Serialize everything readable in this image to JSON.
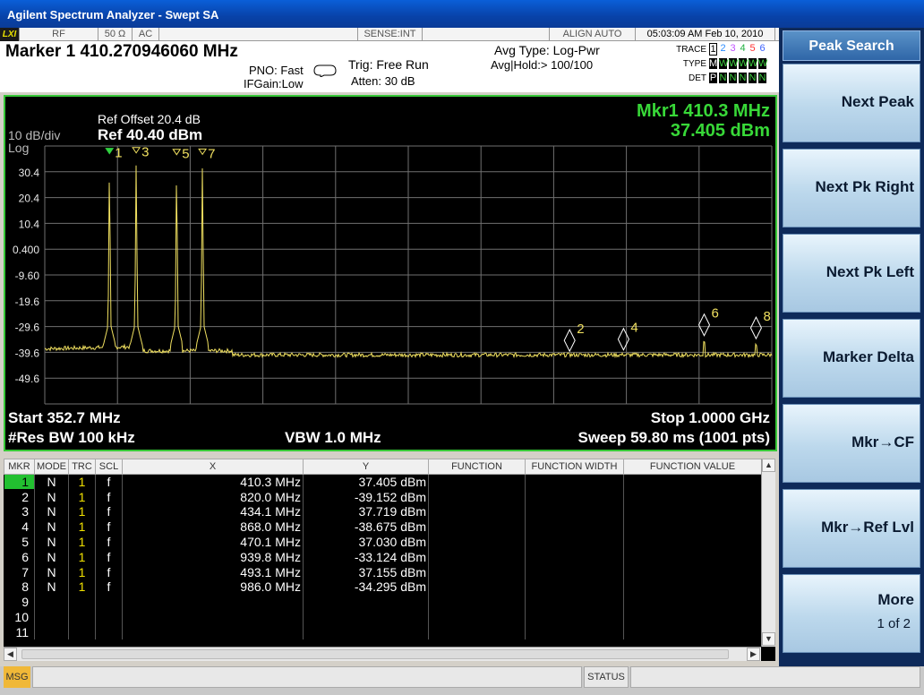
{
  "window": {
    "title": "Agilent Spectrum Analyzer - Swept SA"
  },
  "status_row": {
    "lxi": "LXI",
    "rf": "RF",
    "impedance": "50 Ω",
    "coupling": "AC",
    "sense": "SENSE:INT",
    "align": "ALIGN AUTO",
    "datetime": "05:03:09 AM Feb 10, 2010"
  },
  "marker_readout": "Marker 1 410.270946060 MHz",
  "settings": {
    "pno": "PNO: Fast",
    "ifgain": "IFGain:Low",
    "trig": "Trig: Free Run",
    "atten": "Atten: 30 dB",
    "avg_type": "Avg Type: Log-Pwr",
    "avg_hold": "Avg|Hold:> 100/100"
  },
  "trace_box": {
    "trace_label": "TRACE",
    "trace_vals": [
      "1",
      "2",
      "3",
      "4",
      "5",
      "6"
    ],
    "trace_colors": [
      "#e8d800",
      "#2a8cff",
      "#c050ff",
      "#20b040",
      "#ff3030",
      "#3a60ff"
    ],
    "type_label": "TYPE",
    "type_vals": [
      "M",
      "W",
      "W",
      "W",
      "W",
      "W"
    ],
    "det_label": "DET",
    "det_vals": [
      "P",
      "N",
      "N",
      "N",
      "N",
      "N"
    ]
  },
  "plot": {
    "ref_offset": "Ref Offset 20.4 dB",
    "ref_level": "Ref 40.40 dBm",
    "scale": "10 dB/div",
    "scale_type": "Log",
    "mkr_freq": "Mkr1 410.3 MHz",
    "mkr_amp": "37.405 dBm",
    "y_ticks": [
      "30.4",
      "20.4",
      "10.4",
      "0.400",
      "-9.60",
      "-19.6",
      "-29.6",
      "-39.6",
      "-49.6"
    ],
    "start": "Start 352.7 MHz",
    "stop": "Stop 1.0000 GHz",
    "res_bw": "#Res BW 100 kHz",
    "vbw": "VBW 1.0 MHz",
    "sweep": "Sweep  59.80 ms (1001 pts)",
    "trace_color": "#f0e060",
    "grid_color": "#707070"
  },
  "chart_data": {
    "type": "line",
    "title": "",
    "xlabel": "",
    "ylabel": "",
    "x_unit": "MHz",
    "y_unit": "dBm",
    "xlim": [
      352.7,
      1000.0
    ],
    "ylim": [
      -59.6,
      40.4
    ],
    "noise_floor_low_band": -38.2,
    "noise_floor_high_band": -40.6,
    "peaks": [
      {
        "marker": "1",
        "x": 410.3,
        "y": 37.405
      },
      {
        "marker": "3",
        "x": 434.1,
        "y": 37.719
      },
      {
        "marker": "5",
        "x": 470.1,
        "y": 37.03
      },
      {
        "marker": "7",
        "x": 493.1,
        "y": 37.155
      },
      {
        "marker": "2",
        "x": 820.0,
        "y": -39.152
      },
      {
        "marker": "4",
        "x": 868.0,
        "y": -38.675
      },
      {
        "marker": "6",
        "x": 939.8,
        "y": -33.124
      },
      {
        "marker": "8",
        "x": 986.0,
        "y": -34.295
      }
    ]
  },
  "table": {
    "headers": [
      "MKR",
      "MODE",
      "TRC",
      "SCL",
      "X",
      "Y",
      "FUNCTION",
      "FUNCTION WIDTH",
      "FUNCTION VALUE"
    ],
    "rows": [
      [
        "1",
        "N",
        "1",
        "f",
        "410.3 MHz",
        "37.405 dBm"
      ],
      [
        "2",
        "N",
        "1",
        "f",
        "820.0 MHz",
        "-39.152 dBm"
      ],
      [
        "3",
        "N",
        "1",
        "f",
        "434.1 MHz",
        "37.719 dBm"
      ],
      [
        "4",
        "N",
        "1",
        "f",
        "868.0 MHz",
        "-38.675 dBm"
      ],
      [
        "5",
        "N",
        "1",
        "f",
        "470.1 MHz",
        "37.030 dBm"
      ],
      [
        "6",
        "N",
        "1",
        "f",
        "939.8 MHz",
        "-33.124 dBm"
      ],
      [
        "7",
        "N",
        "1",
        "f",
        "493.1 MHz",
        "37.155 dBm"
      ],
      [
        "8",
        "N",
        "1",
        "f",
        "986.0 MHz",
        "-34.295 dBm"
      ],
      [
        "9",
        "",
        "",
        "",
        "",
        ""
      ],
      [
        "10",
        "",
        "",
        "",
        "",
        ""
      ],
      [
        "11",
        "",
        "",
        "",
        "",
        ""
      ]
    ],
    "active_row": 0
  },
  "statusbar": {
    "msg": "MSG",
    "status": "STATUS"
  },
  "softkeys": {
    "title": "Peak Search",
    "keys": [
      {
        "label": "Next Peak",
        "sub": ""
      },
      {
        "label": "Next Pk Right",
        "sub": ""
      },
      {
        "label": "Next Pk Left",
        "sub": ""
      },
      {
        "label": "Marker Delta",
        "sub": ""
      },
      {
        "label": "Mkr→CF",
        "sub": ""
      },
      {
        "label": "Mkr→Ref Lvl",
        "sub": ""
      },
      {
        "label": "More",
        "sub": "1 of 2"
      }
    ]
  }
}
